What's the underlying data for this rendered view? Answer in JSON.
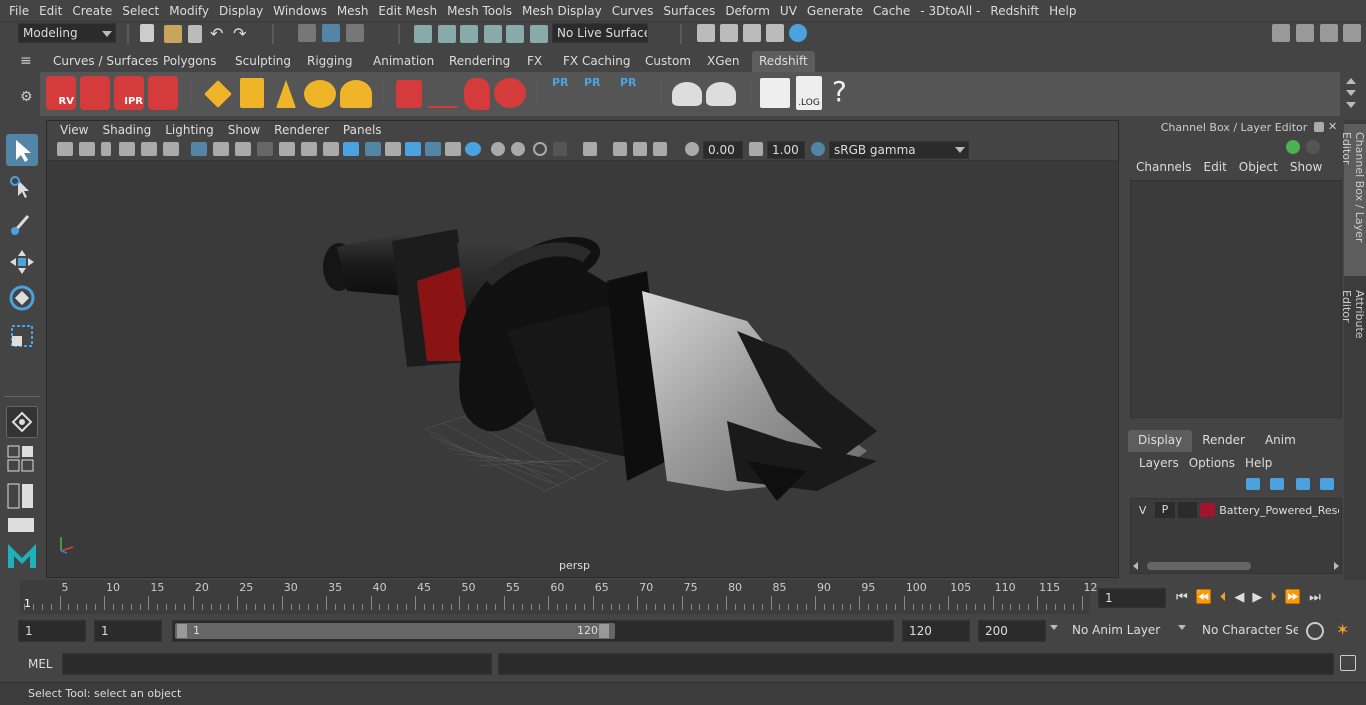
{
  "menubar": [
    "File",
    "Edit",
    "Create",
    "Select",
    "Modify",
    "Display",
    "Windows",
    "Mesh",
    "Edit Mesh",
    "Mesh Tools",
    "Mesh Display",
    "Curves",
    "Surfaces",
    "Deform",
    "UV",
    "Generate",
    "Cache",
    "- 3DtoAll -",
    "Redshift",
    "Help"
  ],
  "status": {
    "mode": "Modeling",
    "live_surface": "No Live Surface"
  },
  "shelf_tabs": [
    "Curves / Surfaces",
    "Polygons",
    "Sculpting",
    "Rigging",
    "Animation",
    "Rendering",
    "FX",
    "FX Caching",
    "Custom",
    "XGen",
    "Redshift"
  ],
  "shelf_active": "Redshift",
  "shelf_labels": {
    "rv": "RV",
    "ipr": "IPR",
    "pr": "PR",
    "log": ".LOG",
    "q": "?"
  },
  "viewport": {
    "menu": [
      "View",
      "Shading",
      "Lighting",
      "Show",
      "Renderer",
      "Panels"
    ],
    "exposure": "0.00",
    "gamma": "1.00",
    "colorspace": "sRGB gamma",
    "camera": "persp"
  },
  "channel_box": {
    "title": "Channel Box / Layer Editor",
    "menu": [
      "Channels",
      "Edit",
      "Object",
      "Show"
    ],
    "layer_tabs": [
      "Display",
      "Render",
      "Anim"
    ],
    "layer_menu": [
      "Layers",
      "Options",
      "Help"
    ],
    "layer": {
      "v": "V",
      "p": "P",
      "name": "Battery_Powered_Resc",
      "color": "#a0142e"
    }
  },
  "side_tabs": [
    "Channel Box / Layer Editor",
    "Attribute Editor"
  ],
  "timeline": {
    "ticks": [
      "5",
      "10",
      "15",
      "20",
      "25",
      "30",
      "35",
      "40",
      "45",
      "50",
      "55",
      "60",
      "65",
      "70",
      "75",
      "80",
      "85",
      "90",
      "95",
      "100",
      "105",
      "110",
      "115",
      "12"
    ],
    "start_marker": "1",
    "current_frame": "1"
  },
  "range": {
    "start": "1",
    "playback_start": "1",
    "slider_start": "1",
    "slider_end": "120",
    "playback_end": "120",
    "end": "200",
    "anim_layer": "No Anim Layer",
    "char_set": "No Character Set"
  },
  "cmd": {
    "label": "MEL"
  },
  "help": {
    "text": "Select Tool: select an object"
  },
  "colors": {
    "accent": "#5285a6",
    "red_shelf": "#d63b3b",
    "blue_shelf": "#4aa3df",
    "gold_shelf": "#f0b429"
  }
}
